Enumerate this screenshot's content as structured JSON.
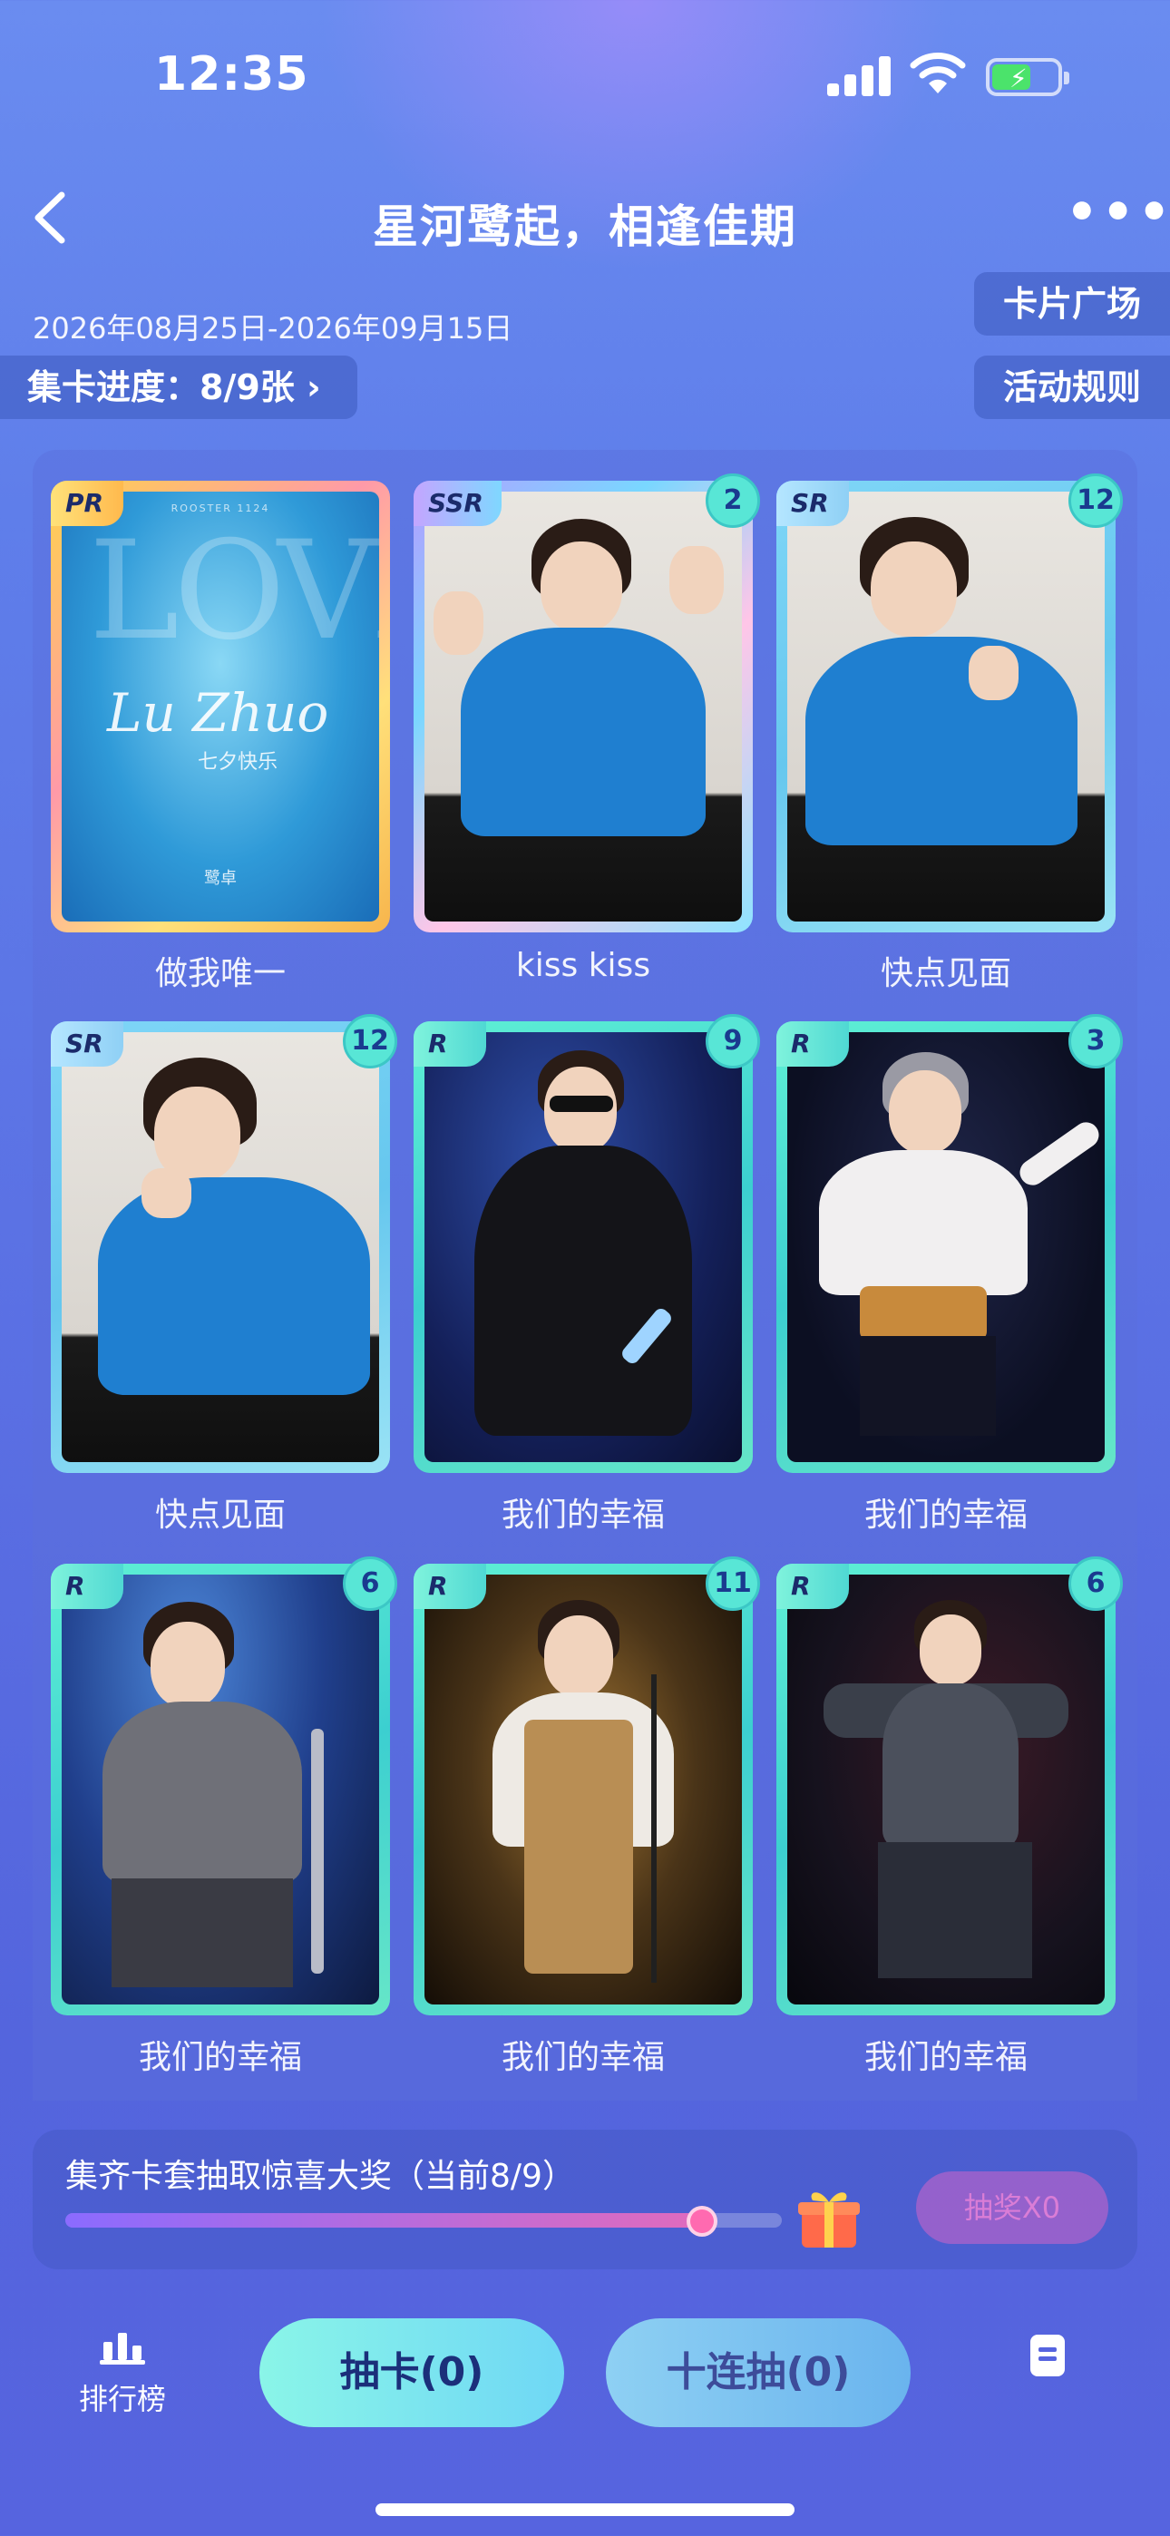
{
  "status_bar": {
    "time": "12:35"
  },
  "header": {
    "title": "星河鹭起，相逢佳期",
    "more": "•••"
  },
  "event": {
    "date_range": "2026年08月25日-2026年09月15日",
    "progress_pill": "集卡进度：8/9张 ›",
    "card_plaza": "卡片广场",
    "rules": "活动规则"
  },
  "cards": [
    {
      "rarity": "PR",
      "name": "做我唯一",
      "count": "",
      "love_title": "LOVE",
      "love_sign": "Lu Zhuo",
      "love_small": "七夕快乐",
      "love_name": "鹭卓",
      "love_top": "ROOSTER 1124"
    },
    {
      "rarity": "SSR",
      "name": "kiss kiss",
      "count": "2"
    },
    {
      "rarity": "SR",
      "name": "快点见面",
      "count": "12"
    },
    {
      "rarity": "SR",
      "name": "快点见面",
      "count": "12"
    },
    {
      "rarity": "R",
      "name": "我们的幸福",
      "count": "9"
    },
    {
      "rarity": "R",
      "name": "我们的幸福",
      "count": "3"
    },
    {
      "rarity": "R",
      "name": "我们的幸福",
      "count": "6"
    },
    {
      "rarity": "R",
      "name": "我们的幸福",
      "count": "11"
    },
    {
      "rarity": "R",
      "name": "我们的幸福",
      "count": "6"
    }
  ],
  "progress": {
    "label": "集齐卡套抽取惊喜大奖（当前8/9）",
    "fraction": 0.889,
    "prize_button": "抽奖X0"
  },
  "bottom": {
    "rank_label": "排行榜",
    "draw_button": "抽卡(0)",
    "ten_draw_button": "十连抽(0)"
  },
  "colors": {
    "accent": "#5664df",
    "card_frame_r": "#5ff0d5",
    "card_frame_pr": "#ffd34d"
  }
}
